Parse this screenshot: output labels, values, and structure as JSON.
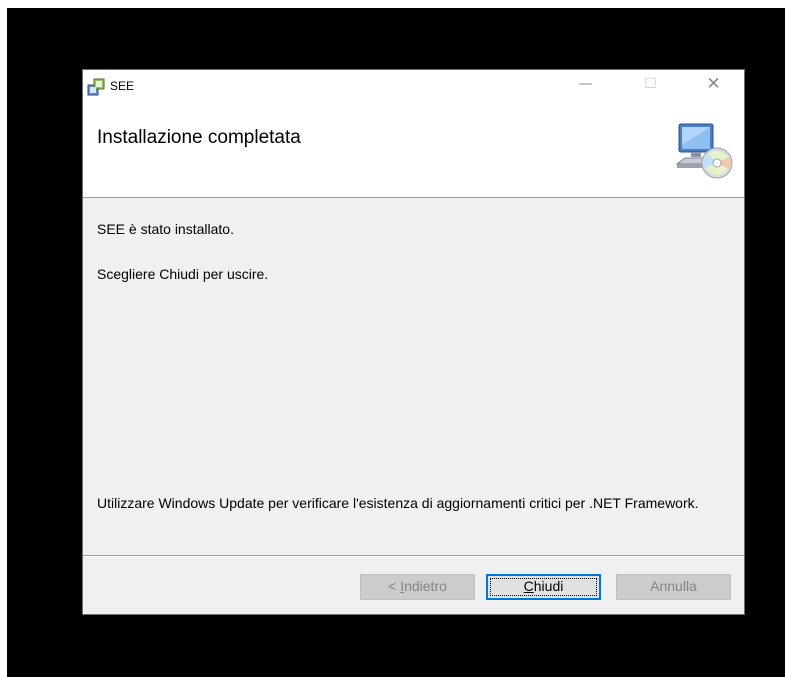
{
  "window": {
    "title": "SEE",
    "controls": {
      "minimize": "—",
      "maximize": "☐",
      "close": "✕"
    }
  },
  "banner": {
    "heading": "Installazione completata",
    "icon": "computer-cd-icon"
  },
  "content": {
    "line1": "SEE è stato installato.",
    "line2": "Scegliere Chiudi per uscire.",
    "note": "Utilizzare Windows Update per verificare l'esistenza di aggiornamenti critici per .NET Framework."
  },
  "buttons": {
    "back": {
      "prefix": "< ",
      "mnemonic": "I",
      "rest": "ndietro",
      "enabled": false
    },
    "close": {
      "mnemonic": "C",
      "rest": "hiudi",
      "enabled": true
    },
    "cancel": {
      "label": "Annulla",
      "enabled": false
    }
  },
  "colors": {
    "background": "#000000",
    "dialog": "#f0f0f0",
    "banner": "#ffffff",
    "focus_border": "#0078d7",
    "disabled_text": "#838383"
  }
}
